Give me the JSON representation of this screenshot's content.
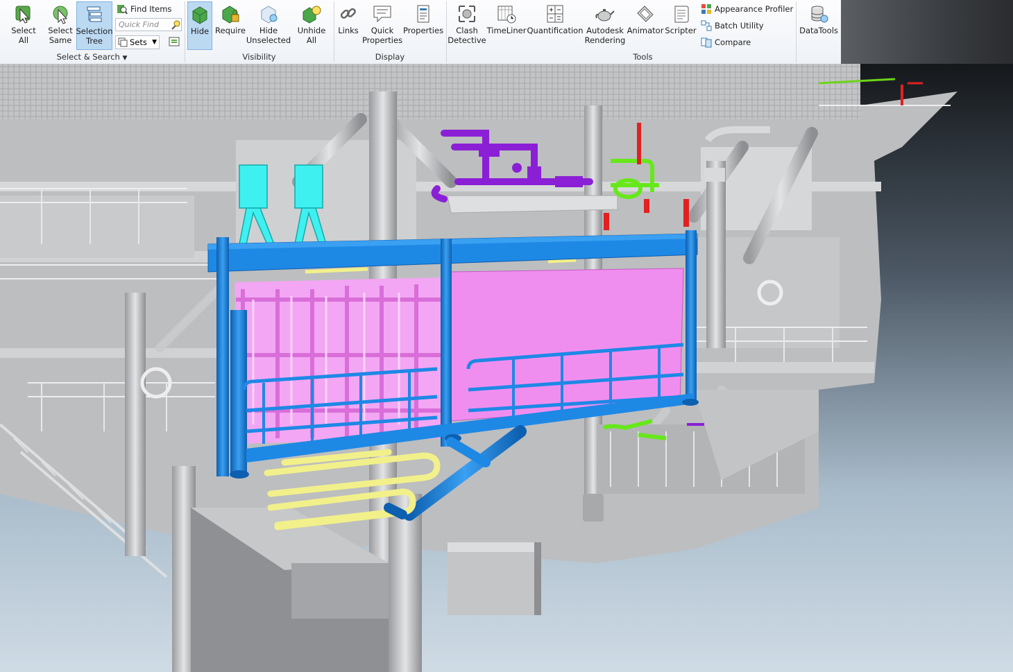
{
  "ribbon": {
    "select_search": {
      "select_all": [
        "Select",
        "All"
      ],
      "select_same": [
        "Select",
        "Same"
      ],
      "selection_tree": [
        "Selection",
        "Tree"
      ],
      "find_items": "Find Items",
      "quick_find_placeholder": "Quick Find",
      "sets": "Sets",
      "group_label": "Select & Search"
    },
    "visibility": {
      "hide": "Hide",
      "require": "Require",
      "hide_unselected": [
        "Hide",
        "Unselected"
      ],
      "unhide_all": [
        "Unhide",
        "All"
      ],
      "group_label": "Visibility"
    },
    "display": {
      "links": "Links",
      "quick_properties": [
        "Quick",
        "Properties"
      ],
      "properties": "Properties",
      "group_label": "Display"
    },
    "tools": {
      "clash_detective": [
        "Clash",
        "Detective"
      ],
      "timeliner": "TimeLiner",
      "quantification": "Quantification",
      "autodesk_rendering": [
        "Autodesk",
        "Rendering"
      ],
      "animator": "Animator",
      "scripter": "Scripter",
      "appearance_profiler": "Appearance Profiler",
      "batch_utility": "Batch Utility",
      "compare": "Compare",
      "group_label": "Tools"
    },
    "datatools": "DataTools"
  },
  "colors": {
    "selection_blue": "#1e88e5",
    "pink_equipment": "#f08ef0",
    "cyan_equipment": "#3ff0f0",
    "purple_piping": "#8b1fd6",
    "green_piping": "#66e81a",
    "yellow_piping": "#f2f08a",
    "red_piping": "#e22020",
    "structure_grey": "#c4c5c7"
  }
}
